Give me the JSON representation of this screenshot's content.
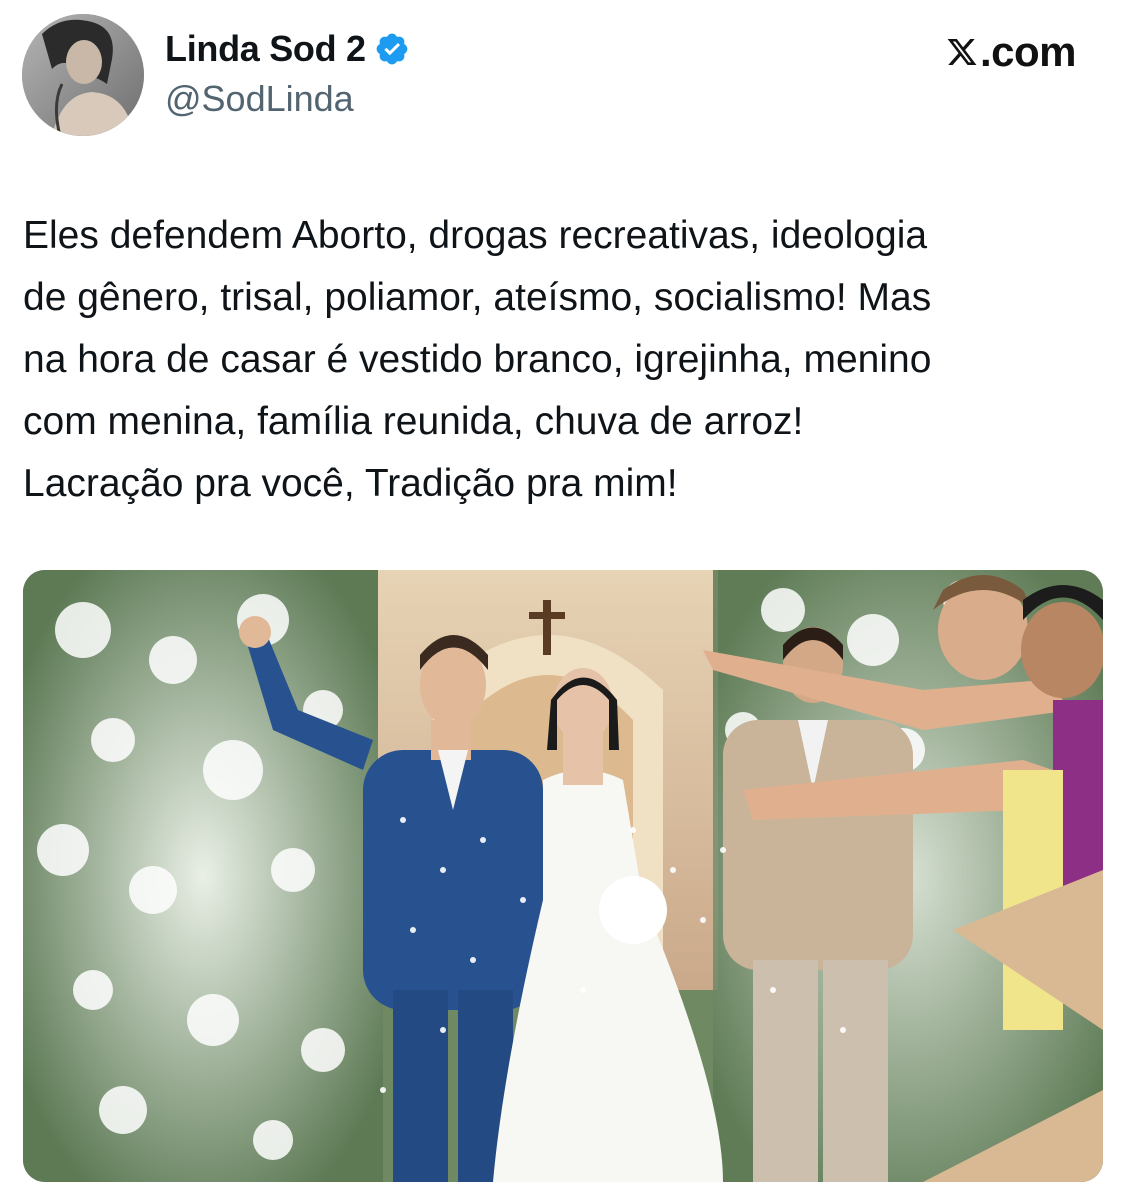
{
  "tweet": {
    "author": {
      "display_name": "Linda Sod 2",
      "handle": "@SodLinda",
      "verified": true,
      "verified_icon": "verified-badge-icon",
      "verified_color": "#1d9bf0",
      "avatar_icon": "user-avatar-photo"
    },
    "brand": {
      "name": ".com",
      "logo_icon": "x-logo-icon"
    },
    "text": "Eles defendem Aborto, drogas recreativas, ideologia\nde gênero, trisal, poliamor, ateísmo, socialismo! Mas\nna hora de casar é vestido branco, igrejinha, menino\ncom menina, família reunida, chuva de arroz!\nLacração pra você, Tradição pra mim!",
    "media": {
      "type": "photo",
      "icon": "wedding-photo"
    }
  },
  "colors": {
    "text_primary": "#0f1419",
    "text_secondary": "#536471",
    "suit_blue": "#27528f",
    "suit_beige": "#c9b49a"
  }
}
